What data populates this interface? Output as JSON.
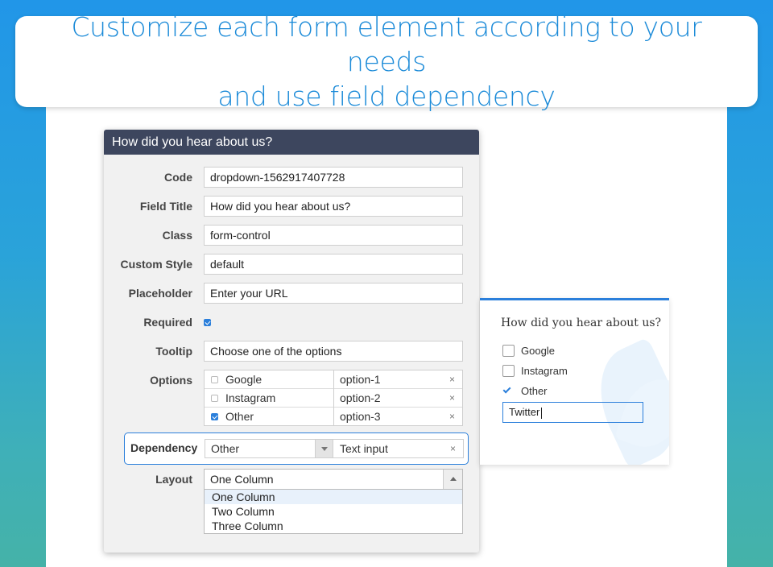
{
  "banner": {
    "line1": "Customize each form element according to your needs",
    "line2": "and use field dependency"
  },
  "editor": {
    "title": "How did you hear about us?",
    "fields": {
      "code": {
        "label": "Code",
        "value": "dropdown-1562917407728"
      },
      "field_title": {
        "label": "Field Title",
        "value": "How did you hear about us?"
      },
      "class": {
        "label": "Class",
        "value": "form-control"
      },
      "custom_style": {
        "label": "Custom Style",
        "value": "default"
      },
      "placeholder": {
        "label": "Placeholder",
        "value": "Enter your URL"
      },
      "required": {
        "label": "Required",
        "checked": true
      },
      "tooltip": {
        "label": "Tooltip",
        "value": "Choose one of the options"
      }
    },
    "options": {
      "label": "Options",
      "items": [
        {
          "name": "Google",
          "value": "option-1",
          "checked": false,
          "remove": "×"
        },
        {
          "name": "Instagram",
          "value": "option-2",
          "checked": false,
          "remove": "×"
        },
        {
          "name": "Other",
          "value": "option-3",
          "checked": true,
          "remove": "×"
        }
      ]
    },
    "dependency": {
      "label": "Dependency",
      "selected": "Other",
      "target": "Text input",
      "remove": "×"
    },
    "layout": {
      "label": "Layout",
      "selected": "One Column",
      "options": [
        "One Column",
        "Two Column",
        "Three Column"
      ]
    }
  },
  "preview": {
    "title": "How did you hear about us?",
    "options": [
      {
        "label": "Google",
        "checked": false
      },
      {
        "label": "Instagram",
        "checked": false
      },
      {
        "label": "Other",
        "checked": true
      }
    ],
    "text_value": "Twitter"
  },
  "colors": {
    "accent": "#2b7fdb",
    "header": "#3d465e",
    "banner_text": "#1a8ad8"
  }
}
